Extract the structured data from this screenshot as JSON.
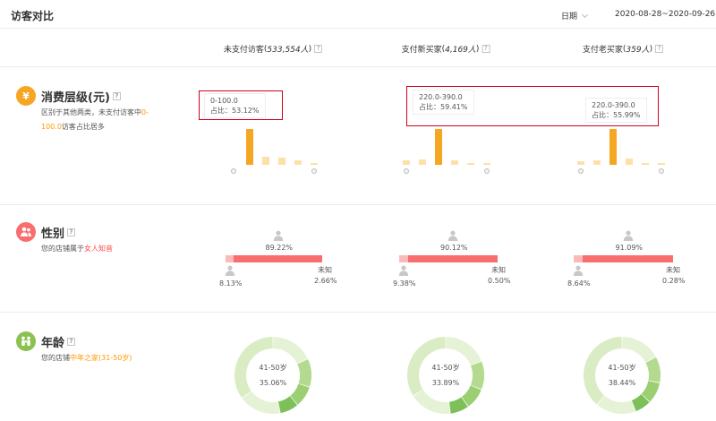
{
  "page": {
    "title": "访客对比",
    "date_label": "日期",
    "date_range": "2020-08-28~2020-09-26"
  },
  "columns": [
    {
      "label": "未支付访客",
      "count": "533,554人"
    },
    {
      "label": "支付新买家",
      "count": "4,169人"
    },
    {
      "label": "支付老买家",
      "count": "359人"
    }
  ],
  "help_mark": "?",
  "spending": {
    "icon": "¥",
    "title": "消费层级(元)",
    "desc_pre": "区别于其他两类，未支付访客中",
    "desc_hl": "0-100.0",
    "desc_post": "访客占比居多",
    "tooltips": [
      {
        "range": "0-100.0",
        "ratio": "占比：53.12%"
      },
      {
        "range": "220.0-390.0",
        "ratio": "占比：59.41%"
      },
      {
        "range": "220.0-390.0",
        "ratio": "占比：55.99%"
      }
    ],
    "histograms": [
      [
        0,
        53.12,
        12,
        11,
        6,
        2
      ],
      [
        8,
        9,
        59.41,
        8,
        1,
        1
      ],
      [
        6,
        7,
        55.99,
        10,
        3,
        1
      ]
    ],
    "colors": {
      "highlight": "#f5a623",
      "normal": "#fde0a7"
    }
  },
  "gender": {
    "title": "性别",
    "desc_pre": "您的店铺属于",
    "desc_hl": "女人知音",
    "unknown_label": "未知",
    "items": [
      {
        "female_pct": "89.22%",
        "male_pct": "8.13%",
        "unknown_pct": "2.66%",
        "female": 89.22,
        "male": 8.13,
        "unknown": 2.66
      },
      {
        "female_pct": "90.12%",
        "male_pct": "9.38%",
        "unknown_pct": "0.50%",
        "female": 90.12,
        "male": 9.38,
        "unknown": 0.5
      },
      {
        "female_pct": "91.09%",
        "male_pct": "8.64%",
        "unknown_pct": "0.28%",
        "female": 91.09,
        "male": 8.64,
        "unknown": 0.28
      }
    ],
    "colors": {
      "female": "#f86d6d",
      "male": "#fbb9b9"
    }
  },
  "age": {
    "title": "年龄",
    "desc_pre": "您的店铺",
    "desc_hl": "中年之家(31-50岁)",
    "donuts": [
      {
        "label": "41-50岁",
        "pct": "35.06%",
        "segments": [
          35.06,
          18,
          12,
          9,
          8,
          18
        ]
      },
      {
        "label": "41-50岁",
        "pct": "33.89%",
        "segments": [
          33.89,
          19,
          12,
          9,
          8,
          18
        ]
      },
      {
        "label": "41-50岁",
        "pct": "38.44%",
        "segments": [
          38.44,
          17,
          11,
          9,
          7,
          17
        ]
      }
    ],
    "colors": [
      "#d9ecc3",
      "#e5f2d5",
      "#b3da8e",
      "#9ccf72",
      "#7dc05a",
      "#e5f2d5"
    ]
  }
}
